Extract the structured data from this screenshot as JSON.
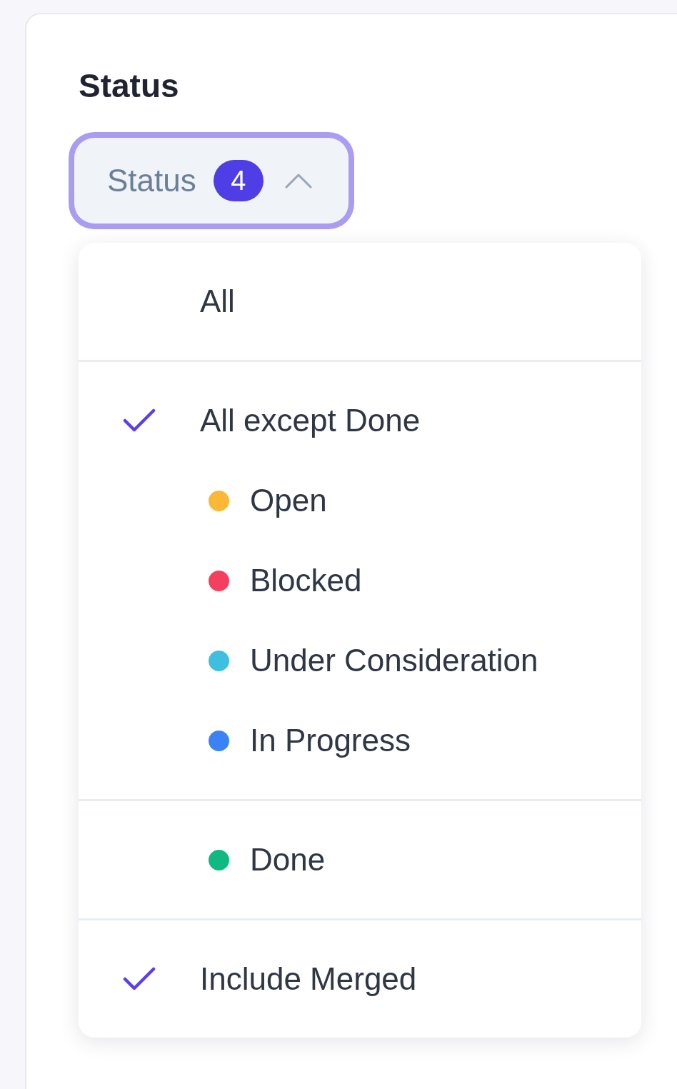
{
  "section_title": "Status",
  "filter_button": {
    "label": "Status",
    "count": "4",
    "expanded": true
  },
  "menu": {
    "sections": [
      {
        "items": [
          {
            "kind": "option",
            "label": "All",
            "checked": false
          }
        ]
      },
      {
        "items": [
          {
            "kind": "option",
            "label": "All except Done",
            "checked": true
          },
          {
            "kind": "status",
            "label": "Open",
            "color": "#fbb736"
          },
          {
            "kind": "status",
            "label": "Blocked",
            "color": "#f43f5e"
          },
          {
            "kind": "status",
            "label": "Under Consideration",
            "color": "#3fbfdf"
          },
          {
            "kind": "status",
            "label": "In Progress",
            "color": "#3b82f6"
          }
        ]
      },
      {
        "items": [
          {
            "kind": "status",
            "label": "Done",
            "color": "#10b981"
          }
        ]
      },
      {
        "items": [
          {
            "kind": "option",
            "label": "Include Merged",
            "checked": true
          }
        ]
      }
    ]
  }
}
